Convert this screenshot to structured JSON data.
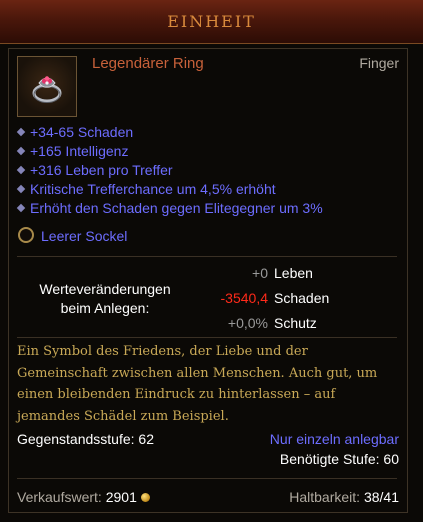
{
  "header": {
    "title": "EINHEIT"
  },
  "item": {
    "name": "Legendärer Ring",
    "slot": "Finger",
    "name_color": "#c8613a"
  },
  "stats": [
    "+34-65 Schaden",
    "+165 Intelligenz",
    "+316 Leben pro Treffer",
    "Kritische Trefferchance um 4,5% erhöht",
    "Erhöht den Schaden gegen Elitegegner um 3%"
  ],
  "socket": {
    "label": "Leerer Sockel",
    "icon": "empty-socket-icon"
  },
  "comparison": {
    "label_line1": "Werteveränderungen",
    "label_line2": "beim Anlegen:",
    "rows": [
      {
        "value": "+0",
        "name": "Leben",
        "color": "#9a9a9a"
      },
      {
        "value": "-3540,4",
        "name": "Schaden",
        "color": "#ff2a1a"
      },
      {
        "value": "+0,0%",
        "name": "Schutz",
        "color": "#9a9a9a"
      }
    ]
  },
  "flavor": {
    "lines": [
      "Ein Symbol des Friedens, der Liebe und der",
      "Gemeinschaft zwischen allen Menschen. Auch gut, um",
      "einen bleibenden Eindruck zu hinterlassen – auf",
      "jemandes Schädel zum Beispiel."
    ]
  },
  "footer": {
    "item_level": "Gegenstandsstufe: 62",
    "account_bound": "Nur einzeln anlegbar",
    "required_level": "Benötigte Stufe: 60",
    "sell_label": "Verkaufswert:",
    "sell_value": "2901",
    "durability_label": "Haltbarkeit:",
    "durability_value": "38/41"
  },
  "colors": {
    "magic_blue": "#6d6dff",
    "flavor_gold": "#c9a957",
    "negative_red": "#ff2a1a"
  }
}
